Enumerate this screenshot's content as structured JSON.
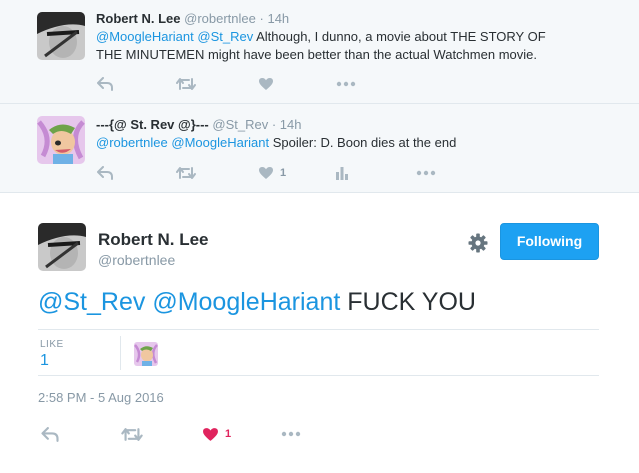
{
  "replies": [
    {
      "name": "Robert N. Lee",
      "handle": "@robertnlee",
      "time": "14h",
      "mentions": [
        "@MoogleHariant",
        "@St_Rev"
      ],
      "text_line1": "Although, I dunno, a movie about THE STORY OF",
      "text_line2": "THE MINUTEMEN might have been better than the actual Watchmen movie.",
      "actions": {
        "reply_icon": "reply-icon",
        "retweet_icon": "retweet-icon",
        "like_icon": "heart-icon",
        "more_icon": "more-dots-icon"
      }
    },
    {
      "name": "---{@ St. Rev @}---",
      "handle": "@St_Rev",
      "time": "14h",
      "mentions": [
        "@robertnlee",
        "@MoogleHariant"
      ],
      "text": "Spoiler: D. Boon dies at the end",
      "like_count": "1",
      "actions": {
        "reply_icon": "reply-icon",
        "retweet_icon": "retweet-icon",
        "like_icon": "heart-icon",
        "analytics_icon": "analytics-icon",
        "more_icon": "more-dots-icon"
      }
    }
  ],
  "main_tweet": {
    "name": "Robert N. Lee",
    "handle": "@robertnlee",
    "follow_label": "Following",
    "mentions": [
      "@St_Rev",
      "@MoogleHariant"
    ],
    "text": "FUCK YOU",
    "likes_label": "LIKE",
    "likes_count": "1",
    "timestamp": "2:58 PM - 5 Aug 2016",
    "like_count": "1"
  },
  "colors": {
    "link": "#1b95e0",
    "follow_button": "#1da1f2",
    "liked_heart": "#e0245e",
    "muted": "#8899a6",
    "icon": "#aab8c2"
  }
}
